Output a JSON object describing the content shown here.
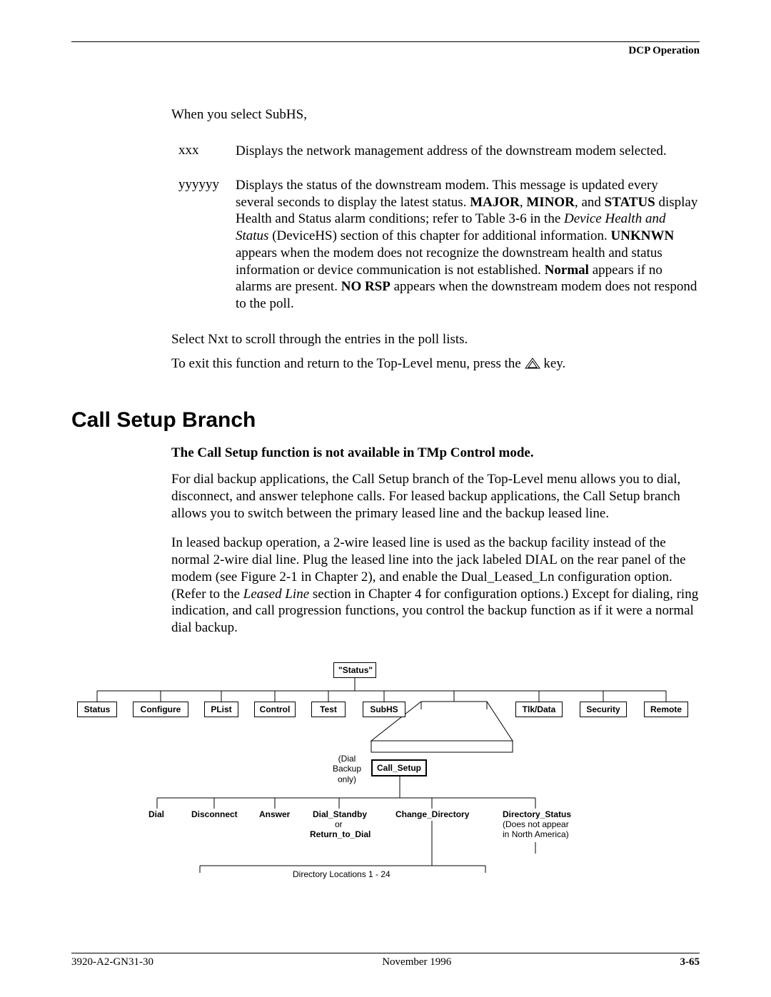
{
  "header": {
    "right": "DCP Operation"
  },
  "intro": "When you select SubHS,",
  "defs": {
    "xxx_key": "xxx",
    "xxx_val": "Displays the network management address of the downstream modem selected.",
    "yyy_key": "yyyyyy",
    "yyy_p1a": "Displays the status of the downstream modem. This message is updated every several seconds to display the latest status. ",
    "yyy_major": "MAJOR",
    "yyy_comma1": ", ",
    "yyy_minor": "MINOR",
    "yyy_comma2": ", and ",
    "yyy_status": "STATUS",
    "yyy_p1b": " display Health and Status alarm conditions; refer to Table 3-6 in the ",
    "yyy_italic": "Device Health and Status",
    "yyy_p1c": " (DeviceHS) section of this chapter for additional information. ",
    "yyy_unknwn": "UNKNWN",
    "yyy_p2": " appears when the modem does not recognize the downstream health and status information or device communication is not established. ",
    "yyy_normal": "Normal",
    "yyy_p3": " appears if no alarms are present. ",
    "yyy_norsp": "NO RSP",
    "yyy_p4": " appears when the downstream modem does not respond to the poll."
  },
  "para_nxt": "Select Nxt to scroll through the entries in the poll lists.",
  "para_exit_a": "To exit this function and return to the Top-Level menu, press the ",
  "para_exit_b": " key.",
  "section_title": "Call Setup Branch",
  "note": "The Call Setup function is not available in TMp Control mode.",
  "para_dial": "For dial backup applications, the Call Setup branch of the Top-Level menu allows you to dial, disconnect, and answer telephone calls. For leased backup applications, the Call Setup branch allows you to switch between the primary leased line and the backup leased line.",
  "para_leased_a": "In leased backup operation, a 2-wire leased line is used as the backup facility instead of the normal 2-wire dial line. Plug the leased line into the jack labeled DIAL on the rear panel of the modem (see Figure 2-1 in Chapter 2), and enable the Dual_Leased_Ln configuration option. (Refer to the ",
  "para_leased_italic": "Leased Line",
  "para_leased_b": " section in Chapter 4 for configuration options.) Except for dialing, ring indication, and call progression functions, you control the backup function as if it were a normal dial backup.",
  "diagram": {
    "status_top": "\"Status\"",
    "row": {
      "status": "Status",
      "configure": "Configure",
      "plist": "PList",
      "control": "Control",
      "test": "Test",
      "subhs": "SubHS",
      "tlkdata": "Tlk/Data",
      "security": "Security",
      "remote": "Remote"
    },
    "call_setup": "Call_Setup",
    "dial_backup_note": "(Dial\nBackup\nonly)",
    "bottom": {
      "dial": "Dial",
      "disconnect": "Disconnect",
      "answer": "Answer",
      "dial_standby": "Dial_Standby",
      "or": "or",
      "return_to_dial": "Return_to_Dial",
      "change_directory": "Change_Directory",
      "directory_status": "Directory_Status",
      "na_note": "(Does not appear\nin North America)"
    },
    "dir_loc": "Directory Locations 1 - 24"
  },
  "footer": {
    "left": "3920-A2-GN31-30",
    "center": "November 1996",
    "right": "3-65"
  }
}
